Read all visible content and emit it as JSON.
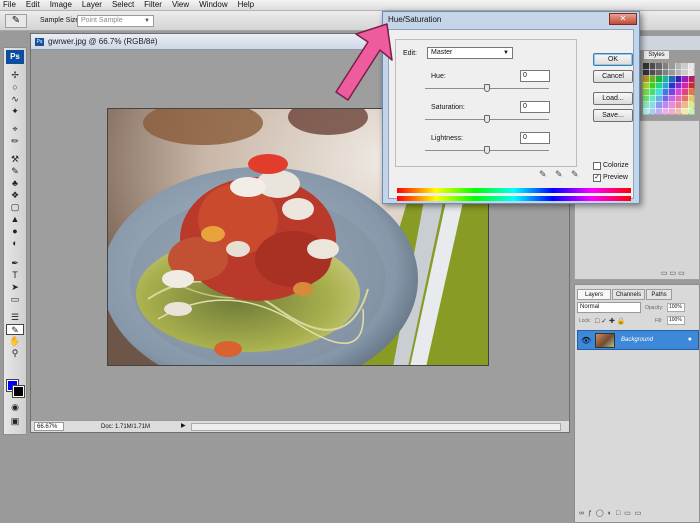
{
  "menu": [
    "File",
    "Edit",
    "Image",
    "Layer",
    "Select",
    "Filter",
    "View",
    "Window",
    "Help"
  ],
  "options": {
    "tool_icon": "eyedropper-icon",
    "sample_label": "Sample Size:",
    "sample_value": "Point Sample"
  },
  "tools": [
    "Ps"
  ],
  "document": {
    "title": "gwrwer.jpg @ 66.7% (RGB/8#)",
    "zoom": "66.67%",
    "info": "Doc: 1.71M/1.71M"
  },
  "dialog": {
    "title": "Hue/Saturation",
    "edit_label": "Edit:",
    "edit_value": "Master",
    "sliders": [
      {
        "label": "Hue:",
        "value": "0"
      },
      {
        "label": "Saturation:",
        "value": "0"
      },
      {
        "label": "Lightness:",
        "value": "0"
      }
    ],
    "buttons": {
      "ok": "OK",
      "cancel": "Cancel",
      "load": "Load...",
      "save": "Save..."
    },
    "colorize": "Colorize",
    "preview": "Preview",
    "colorize_checked": false,
    "preview_checked": true
  },
  "panels": {
    "styles_tab": "Styles",
    "layers_tabs": [
      "Layers",
      "Channels",
      "Paths"
    ],
    "blend_mode": "Normal",
    "opacity_label": "Opacity:",
    "opacity_value": "100%",
    "lock_label": "Lock:",
    "fill_label": "Fill:",
    "fill_value": "100%",
    "layer_name": "Background"
  },
  "colors": {
    "foreground": "#0000ff",
    "background": "#000000",
    "accent": "#3d88d8",
    "arrow": "#ee5c9e"
  }
}
